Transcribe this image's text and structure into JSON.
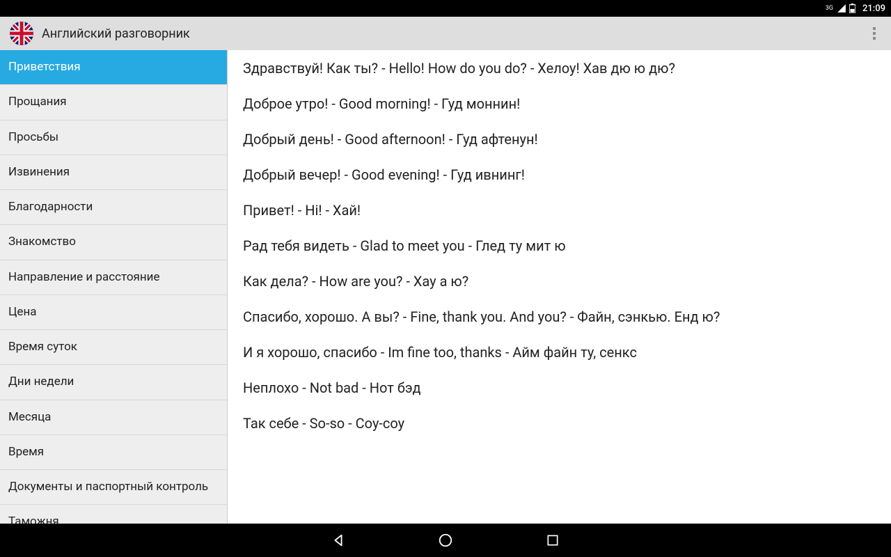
{
  "statusbar": {
    "network_label": "3G",
    "time": "21:09"
  },
  "appbar": {
    "title": "Английский разговорник"
  },
  "sidebar": {
    "items": [
      {
        "label": "Приветствия",
        "selected": true
      },
      {
        "label": "Прощания",
        "selected": false
      },
      {
        "label": "Просьбы",
        "selected": false
      },
      {
        "label": "Извинения",
        "selected": false
      },
      {
        "label": "Благодарности",
        "selected": false
      },
      {
        "label": "Знакомство",
        "selected": false
      },
      {
        "label": "Направление и расстояние",
        "selected": false
      },
      {
        "label": "Цена",
        "selected": false
      },
      {
        "label": "Время суток",
        "selected": false
      },
      {
        "label": "Дни недели",
        "selected": false
      },
      {
        "label": "Месяца",
        "selected": false
      },
      {
        "label": "Время",
        "selected": false
      },
      {
        "label": "Документы и паспортный контроль",
        "selected": false
      },
      {
        "label": "Таможня",
        "selected": false
      }
    ]
  },
  "phrases": [
    "Здравствуй! Как ты? - Hello! How do you do? - Хелоу! Хав дю ю дю?",
    "Доброе утро! - Good morning! - Гуд моннин!",
    "Добрый день! - Good afternoon! - Гуд афтенун!",
    "Добрый вечер! - Good evening! - Гуд ивнинг!",
    "Привет! - Hi! - Хай!",
    "Рад тебя видеть - Glad to meet you - Глед ту мит ю",
    "Как дела? - How are you? - Хау а ю?",
    "Спасибо, хорошо. А вы? - Fine, thank you. And you? - Файн, сэнкью. Енд ю?",
    "И я хорошо, спасибо - Im fine too, thanks - Айм файн ту, сенкс",
    "Неплохо - Not bad - Нот бэд",
    "Так себе - So-so - Соу-соу"
  ]
}
